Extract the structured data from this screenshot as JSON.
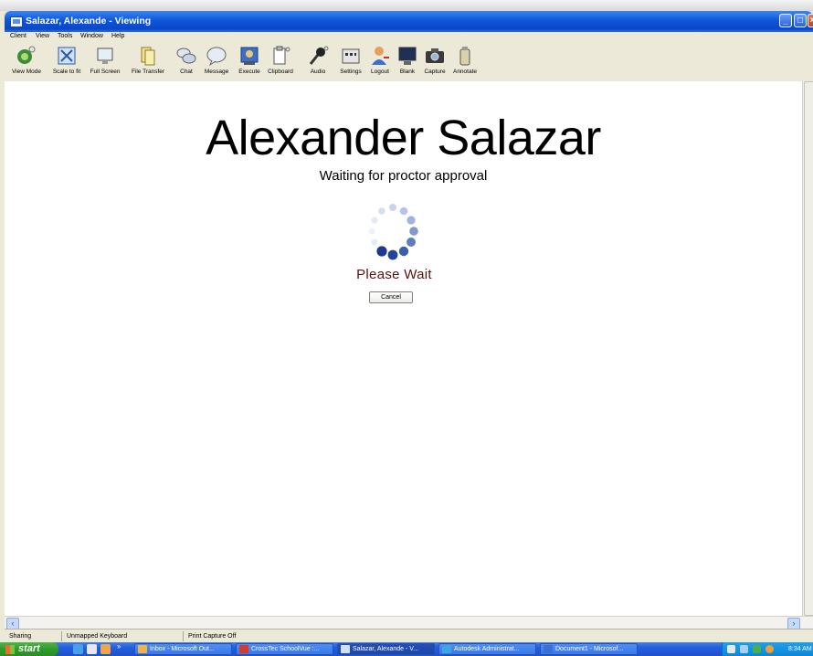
{
  "window": {
    "title": "Salazar, Alexande - Viewing"
  },
  "menu": [
    "Client",
    "View",
    "Tools",
    "Window",
    "Help"
  ],
  "toolbar": [
    {
      "label": "View Mode",
      "icon": "view-mode-icon"
    },
    {
      "label": "Scale to fit",
      "icon": "scale-to-fit-icon"
    },
    {
      "label": "Full Screen",
      "icon": "full-screen-icon"
    },
    {
      "label": "File Transfer",
      "icon": "file-transfer-icon"
    },
    {
      "label": "Chat",
      "icon": "chat-icon"
    },
    {
      "label": "Message",
      "icon": "message-icon"
    },
    {
      "label": "Execute",
      "icon": "execute-icon"
    },
    {
      "label": "Clipboard",
      "icon": "clipboard-icon"
    },
    {
      "label": "Audio",
      "icon": "microphone-icon"
    },
    {
      "label": "Settings",
      "icon": "settings-icon"
    },
    {
      "label": "Logout",
      "icon": "logout-icon"
    },
    {
      "label": "Blank",
      "icon": "blank-icon"
    },
    {
      "label": "Capture",
      "icon": "camera-icon"
    },
    {
      "label": "Annotate",
      "icon": "annotate-icon"
    }
  ],
  "main": {
    "name": "Alexander Salazar",
    "status": "Waiting for proctor approval",
    "please_wait": "Please Wait",
    "cancel_label": "Cancel"
  },
  "statusbar": {
    "sharing": "Sharing",
    "keyboard": "Unmapped Keyboard",
    "print_capture": "Print Capture Off"
  },
  "taskbar": {
    "start_label": "start",
    "buttons": [
      {
        "label": "Inbox - Microsoft Out...",
        "color": "#f0b24a"
      },
      {
        "label": "CrossTec SchoolVue :...",
        "color": "#d63a2a"
      },
      {
        "label": "Salazar, Alexande - V...",
        "color": "#cfe0f7"
      },
      {
        "label": "Autodesk Administrat...",
        "color": "#3fa6e6"
      },
      {
        "label": "Document1 - Microsof...",
        "color": "#3c6fd6"
      }
    ],
    "clock": "8:34 AM"
  },
  "colors": {
    "titlebar": "#0a48c8",
    "please_wait": "#5a1010",
    "spinner_dark": "#1e3f8f",
    "spinner_light": "#d6def0"
  }
}
